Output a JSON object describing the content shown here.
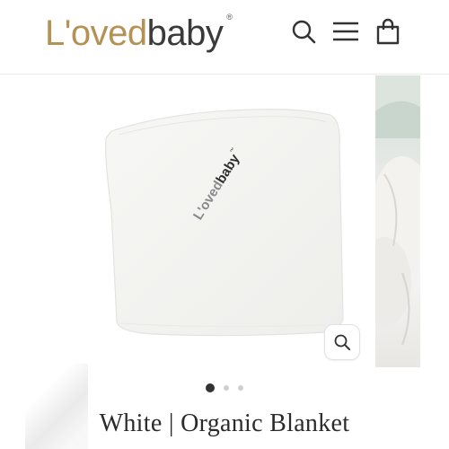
{
  "header": {
    "logo": {
      "part1": "L'oved",
      "part2": "baby",
      "reg": "®"
    },
    "icons": [
      "search-icon",
      "menu-icon",
      "cart-icon"
    ]
  },
  "gallery": {
    "slide_count": 3,
    "active_index": 0,
    "blanket_logo": {
      "part1": "L'oved",
      "part2": "baby",
      "tm": "™"
    },
    "zoom_icon": "zoom-icon"
  },
  "product": {
    "title": "White | Organic Blanket"
  },
  "colors": {
    "brand_gold": "#b49255",
    "brand_dark": "#3a3a3a",
    "active_dot": "#333333",
    "inactive_dot": "#cfcfcf"
  }
}
